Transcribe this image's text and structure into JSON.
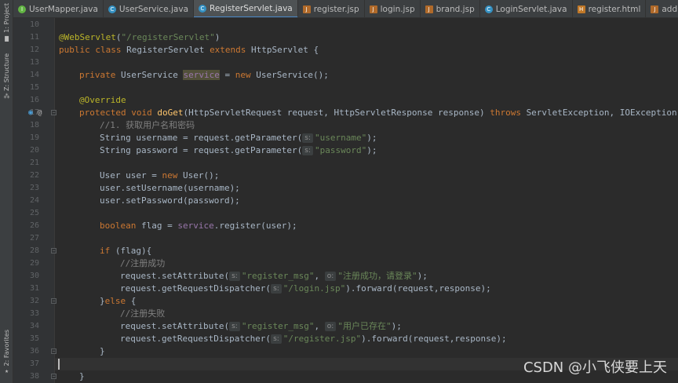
{
  "tool_window_strip": {
    "project_label": "1: Project",
    "structure_label": "Z: Structure",
    "favorites_label": "2: Favorites"
  },
  "tabs": [
    {
      "label": "UserMapper.java",
      "icon": "interface-icon",
      "active": false
    },
    {
      "label": "UserService.java",
      "icon": "class-icon",
      "active": false
    },
    {
      "label": "RegisterServlet.java",
      "icon": "class-icon",
      "active": true
    },
    {
      "label": "register.jsp",
      "icon": "jsp-icon",
      "active": false
    },
    {
      "label": "login.jsp",
      "icon": "jsp-icon",
      "active": false
    },
    {
      "label": "brand.jsp",
      "icon": "jsp-icon",
      "active": false
    },
    {
      "label": "LoginServlet.java",
      "icon": "class-icon",
      "active": false
    },
    {
      "label": "register.html",
      "icon": "html-icon",
      "active": false
    },
    {
      "label": "addBrand.jsp",
      "icon": "jsp-icon",
      "active": false
    }
  ],
  "gutter": {
    "line_numbers": [
      "10",
      "11",
      "12",
      "13",
      "14",
      "15",
      "16",
      "17",
      "18",
      "19",
      "20",
      "21",
      "22",
      "23",
      "24",
      "25",
      "26",
      "27",
      "28",
      "29",
      "30",
      "31",
      "32",
      "33",
      "34",
      "35",
      "36",
      "37",
      "38"
    ]
  },
  "code": {
    "l10": "",
    "l11_ann": "@WebServlet",
    "l11_a": "(",
    "l11_str": "\"/registerServlet\"",
    "l11_b": ")",
    "l12_kw1": "public class ",
    "l12_name": "RegisterServlet ",
    "l12_kw2": "extends ",
    "l12_rest": "HttpServlet {",
    "l14_kw": "private ",
    "l14_type": "UserService ",
    "l14_fld": "service",
    "l14_eq": " = ",
    "l14_kw2": "new ",
    "l14_rest": "UserService();",
    "l16_ann": "@Override",
    "l17_kw": "protected void ",
    "l17_mth": "doGet",
    "l17_params": "(HttpServletRequest request, HttpServletResponse response) ",
    "l17_kw2": "throws ",
    "l17_rest": "ServletException, IOException {",
    "l18_cmt": "//1. 获取用户名和密码",
    "l19_a": "String username = request.getParameter(",
    "l19_hint": "s:",
    "l19_str": "\"username\"",
    "l19_b": ");",
    "l20_a": "String password = request.getParameter(",
    "l20_hint": "s:",
    "l20_str": "\"password\"",
    "l20_b": ");",
    "l22_a": "User user = ",
    "l22_kw": "new ",
    "l22_b": "User();",
    "l23": "user.setUsername(username);",
    "l24": "user.setPassword(password);",
    "l26_kw": "boolean ",
    "l26_a": "flag = ",
    "l26_fld": "service",
    "l26_b": ".register(user);",
    "l28_kw": "if ",
    "l28_a": "(flag){",
    "l29_cmt": "//注册成功",
    "l30_a": "request.setAttribute(",
    "l30_hint1": "s:",
    "l30_str1": "\"register_msg\"",
    "l30_comma": ", ",
    "l30_hint2": "o:",
    "l30_str2": "\"注册成功，请登录\"",
    "l30_b": ");",
    "l31_a": "request.getRequestDispatcher(",
    "l31_hint": "s:",
    "l31_str": "\"/login.jsp\"",
    "l31_b": ").forward(request,response);",
    "l32_a": "}",
    "l32_kw": "else ",
    "l32_b": "{",
    "l33_cmt": "//注册失败",
    "l34_a": "request.setAttribute(",
    "l34_hint1": "s:",
    "l34_str1": "\"register_msg\"",
    "l34_comma": ", ",
    "l34_hint2": "o:",
    "l34_str2": "\"用户已存在\"",
    "l34_b": ");",
    "l35_a": "request.getRequestDispatcher(",
    "l35_hint": "s:",
    "l35_str": "\"/register.jsp\"",
    "l35_b": ").forward(request,response);",
    "l36": "}",
    "l37": "",
    "l38": "}"
  },
  "watermark": "CSDN @小飞侠要上天",
  "colors": {
    "background": "#2b2b2b",
    "keyword": "#cc7832",
    "annotation": "#bbb529",
    "string": "#6a8759",
    "comment": "#808080",
    "field": "#9876aa",
    "method": "#ffc66d",
    "active_tab_underline": "#4a88c7"
  }
}
